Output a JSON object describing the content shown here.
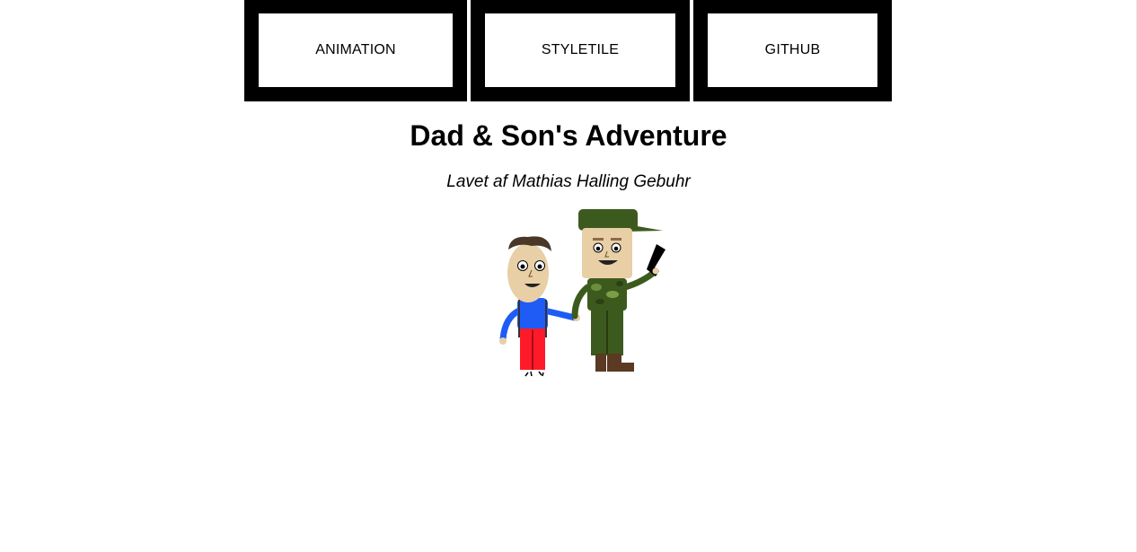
{
  "nav": {
    "items": [
      {
        "label": "ANIMATION"
      },
      {
        "label": "STYLETILE"
      },
      {
        "label": "GITHUB"
      }
    ]
  },
  "header": {
    "title": "Dad & Son's Adventure",
    "subtitle": "Lavet af Mathias Halling Gebuhr"
  },
  "colors": {
    "nav_background": "#000000",
    "button_background": "#ffffff",
    "son_shirt": "#1f5cf5",
    "son_pants": "#ff1a2a",
    "dad_uniform": "#3d5a1e",
    "skin": "#e8cfa6"
  }
}
